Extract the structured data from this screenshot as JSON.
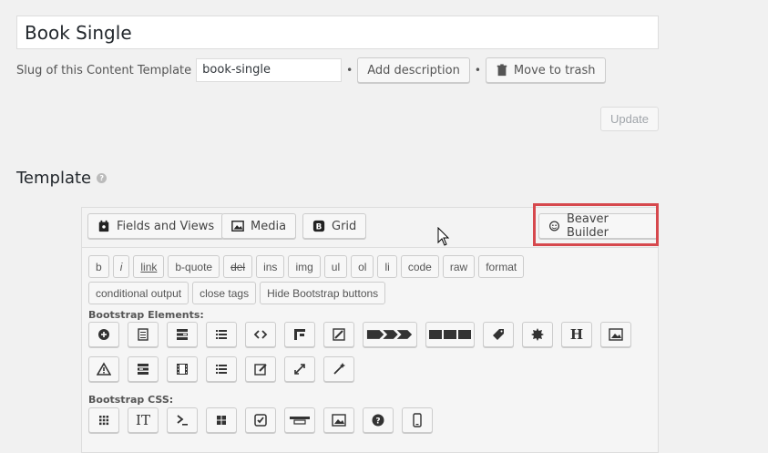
{
  "template": {
    "title_value": "Book Single",
    "slug_label": "Slug of this Content Template",
    "slug_value": "book-single",
    "add_description_label": "Add description",
    "move_to_trash_label": "Move to trash",
    "update_label": "Update",
    "section_title": "Template"
  },
  "toolbar": {
    "fields_views_label": "Fields and Views",
    "media_label": "Media",
    "grid_label": "Grid",
    "beaver_builder_label": "Beaver Builder"
  },
  "quicktags": {
    "row1": [
      "b",
      "i",
      "link",
      "b-quote",
      "del",
      "ins",
      "img",
      "ul",
      "ol",
      "li",
      "code",
      "raw",
      "format"
    ],
    "row2": [
      "conditional output",
      "close tags",
      "Hide Bootstrap buttons"
    ]
  },
  "bootstrap": {
    "elements_label": "Bootstrap Elements:",
    "css_label": "Bootstrap CSS:",
    "elements_row1_icons": [
      "plus-circle-icon",
      "panel-icon",
      "list-group-icon",
      "list-icon",
      "code-icon",
      "jumbotron-icon",
      "edit-off-icon",
      "breadcrumb-icon",
      "button-group-icon",
      "tag-icon",
      "badge-icon",
      "heading-icon",
      "image-icon"
    ],
    "elements_row2_icons": [
      "alert-icon",
      "media-object-icon",
      "video-icon",
      "list-unstyled-icon",
      "edit-icon",
      "expand-icon",
      "magic-wand-icon"
    ],
    "css_icons": [
      "grid-icon",
      "typography-icon",
      "terminal-icon",
      "tiles-icon",
      "checkbox-icon",
      "navbar-icon",
      "image-css-icon",
      "help-circle-icon",
      "mobile-icon"
    ]
  },
  "colors": {
    "highlight": "#d6484d",
    "background": "#f1f1f1"
  }
}
